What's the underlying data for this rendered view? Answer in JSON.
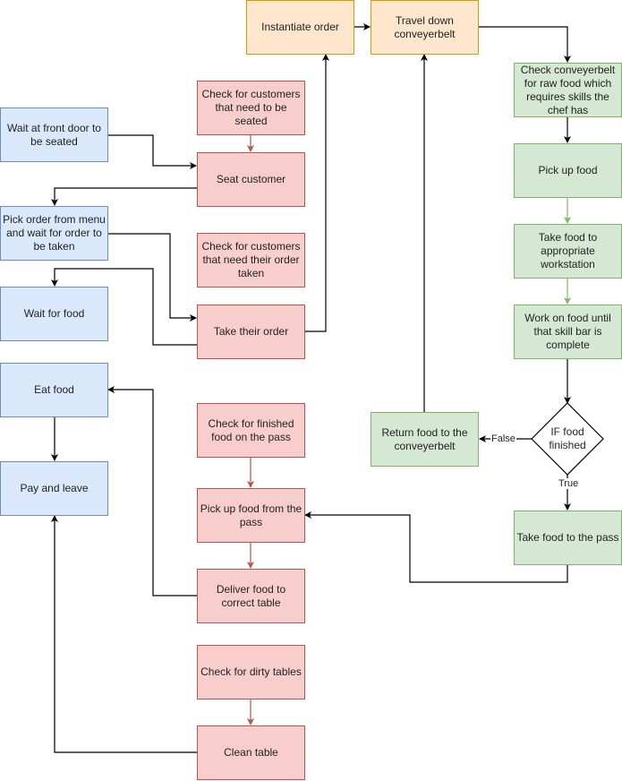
{
  "diagram": {
    "type": "flowchart",
    "colors": {
      "customer_fill": "#dae8fc",
      "customer_stroke": "#6c8ebf",
      "waiter_fill": "#f8cecc",
      "waiter_stroke": "#b85450",
      "chef_fill": "#d5e8d4",
      "chef_stroke": "#82b366",
      "order_fill": "#ffe6cc",
      "order_stroke": "#d79b00",
      "edge_default": "#000000"
    },
    "nodes": {
      "wait_front_door": "Wait at front door to be seated",
      "pick_order_menu": "Pick order from menu and wait for order to be taken",
      "wait_for_food": "Wait for food",
      "eat_food": "Eat food",
      "pay_and_leave": "Pay and leave",
      "check_customers_seated": "Check for customers that need to be seated",
      "seat_customer": "Seat customer",
      "check_customers_order": "Check for customers that need their order taken",
      "take_order": "Take their order",
      "check_finished_food": "Check for finished food on the pass",
      "pick_up_from_pass": "Pick up food from the pass",
      "deliver_food": "Deliver food to correct table",
      "check_dirty_tables": "Check for dirty tables",
      "clean_table": "Clean table",
      "instantiate_order": "Instantiate order",
      "travel_conveyor": "Travel down conveyerbelt",
      "check_conveyor": "Check conveyerbelt for raw food which requires skills the chef has",
      "pick_up_food": "Pick up food",
      "take_to_workstation": "Take food to appropriate workstation",
      "work_on_food": "Work on food until that skill bar is complete",
      "if_food_finished": "IF food finished",
      "return_to_conveyor": "Return food to the conveyerbelt",
      "take_to_pass": "Take food to the pass"
    },
    "edge_labels": {
      "false": "False",
      "true": "True"
    },
    "edges": [
      {
        "from": "wait_front_door",
        "to": "seat_customer",
        "color": "black"
      },
      {
        "from": "check_customers_seated",
        "to": "seat_customer",
        "color": "red"
      },
      {
        "from": "seat_customer",
        "to": "pick_order_menu",
        "color": "black"
      },
      {
        "from": "pick_order_menu",
        "to": "take_order",
        "color": "black"
      },
      {
        "from": "take_order",
        "to": "wait_for_food",
        "color": "black"
      },
      {
        "from": "take_order",
        "to": "instantiate_order",
        "color": "black"
      },
      {
        "from": "instantiate_order",
        "to": "travel_conveyor",
        "color": "black"
      },
      {
        "from": "travel_conveyor",
        "to": "check_conveyor",
        "color": "black"
      },
      {
        "from": "check_conveyor",
        "to": "pick_up_food",
        "color": "black"
      },
      {
        "from": "pick_up_food",
        "to": "take_to_workstation",
        "color": "green"
      },
      {
        "from": "take_to_workstation",
        "to": "work_on_food",
        "color": "green"
      },
      {
        "from": "work_on_food",
        "to": "if_food_finished",
        "color": "black"
      },
      {
        "from": "if_food_finished",
        "to": "return_to_conveyor",
        "color": "black",
        "label": "False"
      },
      {
        "from": "return_to_conveyor",
        "to": "travel_conveyor",
        "color": "black"
      },
      {
        "from": "if_food_finished",
        "to": "take_to_pass",
        "color": "black",
        "label": "True"
      },
      {
        "from": "take_to_pass",
        "to": "pick_up_from_pass",
        "color": "black"
      },
      {
        "from": "check_finished_food",
        "to": "pick_up_from_pass",
        "color": "red"
      },
      {
        "from": "pick_up_from_pass",
        "to": "deliver_food",
        "color": "red"
      },
      {
        "from": "deliver_food",
        "to": "eat_food",
        "color": "black"
      },
      {
        "from": "eat_food",
        "to": "pay_and_leave",
        "color": "black"
      },
      {
        "from": "check_dirty_tables",
        "to": "clean_table",
        "color": "red"
      },
      {
        "from": "clean_table",
        "to": "pay_and_leave",
        "color": "black"
      }
    ]
  }
}
